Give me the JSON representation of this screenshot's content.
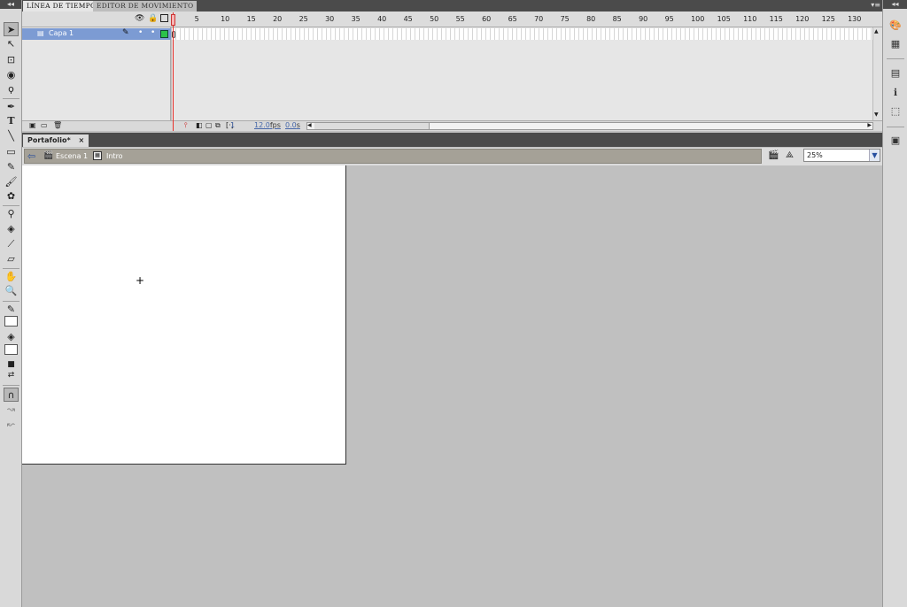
{
  "timeline": {
    "tabs": [
      "LÍNEA DE TIEMPO",
      "EDITOR DE MOVIMIENTO"
    ],
    "layer_name": "Capa 1",
    "ruler_ticks": [
      "5",
      "10",
      "15",
      "20",
      "25",
      "30",
      "35",
      "40",
      "45",
      "50",
      "55",
      "60",
      "65",
      "70",
      "75",
      "80",
      "85",
      "90",
      "95",
      "100",
      "105",
      "110",
      "115",
      "120",
      "125",
      "130"
    ],
    "current_frame": "1",
    "fps": "12.0",
    "fps_unit": "fps",
    "time": "0.0",
    "time_unit": "s"
  },
  "document": {
    "tab_label": "Portafolio*",
    "close_glyph": "×",
    "scene_label": "Escena 1",
    "symbol_label": "Intro",
    "zoom_value": "25%"
  },
  "icons": {
    "toolbar": [
      "selection-icon",
      "subselection-icon",
      "free-transform-icon",
      "3d-rotation-icon",
      "lasso-icon",
      "pen-icon",
      "text-icon",
      "line-icon",
      "rectangle-icon",
      "pencil-icon",
      "brush-icon",
      "deco-icon",
      "bone-icon",
      "paint-bucket-icon",
      "eyedropper-icon",
      "eraser-icon",
      "hand-icon",
      "zoom-icon",
      "stroke-color-icon",
      "fill-color-icon",
      "swap-colors-icon",
      "snap-icon",
      "smooth-icon",
      "straighten-icon"
    ],
    "right": [
      "color-icon",
      "swatches-icon",
      "align-icon",
      "info-icon",
      "transform-icon",
      "library-icon"
    ]
  },
  "colors": {
    "layer_highlight": "#7c9bd3",
    "playhead": "#e8322c",
    "breadcrumb_bar": "#a5a197",
    "keyframe_green": "#2cc24a"
  }
}
